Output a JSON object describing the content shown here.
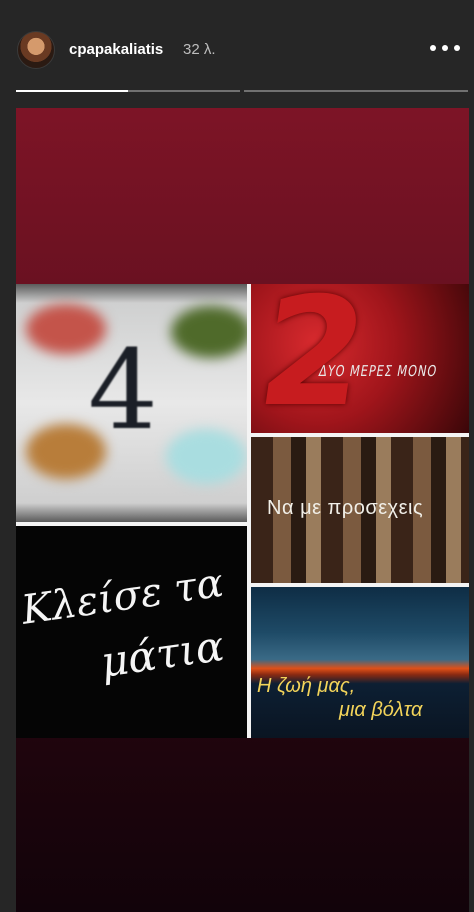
{
  "header": {
    "username": "cpapakaliatis",
    "time": "32 λ.",
    "progress": [
      0.5,
      0.0
    ]
  },
  "story": {
    "tiles": {
      "four": "4",
      "two_big": "2",
      "two_caption": "ΔΥΟ ΜΕΡΕΣ ΜΟΝΟ",
      "na_me": "Να με προσεχεις",
      "kleise_l1": "Κλείσε τα",
      "kleise_l2": "μάτια",
      "zoi_l1": "Η ζωή μας,",
      "zoi_l2": "μια βόλτα"
    }
  },
  "colors": {
    "background": "#262626",
    "story_top": "#7d1426"
  }
}
